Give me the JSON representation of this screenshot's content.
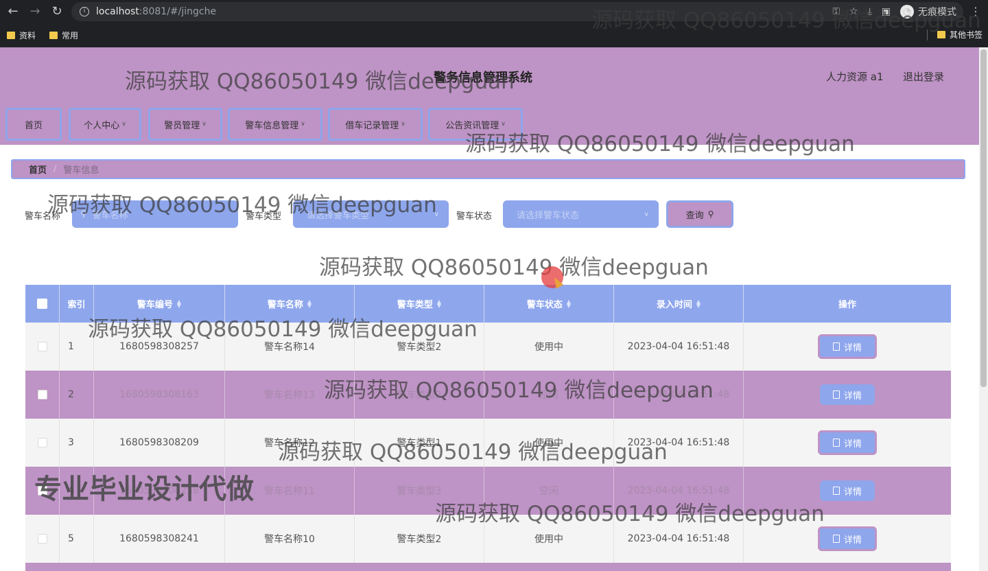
{
  "browser": {
    "url_host": "localhost",
    "url_rest": ":8081/#/jingche",
    "incognito_label": "无痕模式",
    "bookmarks": [
      "资料",
      "常用"
    ],
    "other_bookmarks": "其他书签"
  },
  "header": {
    "title": "警务信息管理系统",
    "user_role": "人力资源 a1",
    "logout": "退出登录"
  },
  "menu": [
    {
      "label": "首页",
      "has_dropdown": false
    },
    {
      "label": "个人中心",
      "has_dropdown": true
    },
    {
      "label": "警员管理",
      "has_dropdown": true
    },
    {
      "label": "警车信息管理",
      "has_dropdown": true
    },
    {
      "label": "借车记录管理",
      "has_dropdown": true
    },
    {
      "label": "公告资讯管理",
      "has_dropdown": true
    }
  ],
  "breadcrumb": {
    "home": "首页",
    "separator": "/",
    "current": "警车信息"
  },
  "search": {
    "name_label": "警车名称",
    "name_placeholder": "警车名称",
    "type_label": "警车类型",
    "type_placeholder": "请选择警车类型",
    "status_label": "警车状态",
    "status_placeholder": "请选择警车状态",
    "query_button": "查询"
  },
  "table": {
    "columns": [
      "索引",
      "警车编号",
      "警车名称",
      "警车类型",
      "警车状态",
      "录入时间",
      "操作"
    ],
    "detail_label": "详情",
    "rows": [
      {
        "index": "1",
        "code": "1680598308257",
        "name": "警车名称14",
        "type": "警车类型2",
        "status": "使用中",
        "time": "2023-04-04 16:51:48"
      },
      {
        "index": "2",
        "code": "1680598308163",
        "name": "警车名称13",
        "type": "警车类型2",
        "status": "空闲",
        "time": "2023-04-04 16:51:48"
      },
      {
        "index": "3",
        "code": "1680598308209",
        "name": "警车名称12",
        "type": "警车类型1",
        "status": "使用中",
        "time": "2023-04-04 16:51:48"
      },
      {
        "index": "4",
        "code": "1680598308258",
        "name": "警车名称11",
        "type": "警车类型3",
        "status": "空闲",
        "time": "2023-04-04 16:51:48"
      },
      {
        "index": "5",
        "code": "1680598308241",
        "name": "警车名称10",
        "type": "警车类型2",
        "status": "使用中",
        "time": "2023-04-04 16:51:48"
      }
    ]
  },
  "watermarks": {
    "text": "源码获取 QQ86050149 微信deepguan",
    "text_partial": "源码获取 QQ86050149 微信deepguan",
    "big_text": "专业毕业设计代做"
  },
  "colors": {
    "purple": "#be93c5",
    "blue": "#8ea6ec"
  }
}
